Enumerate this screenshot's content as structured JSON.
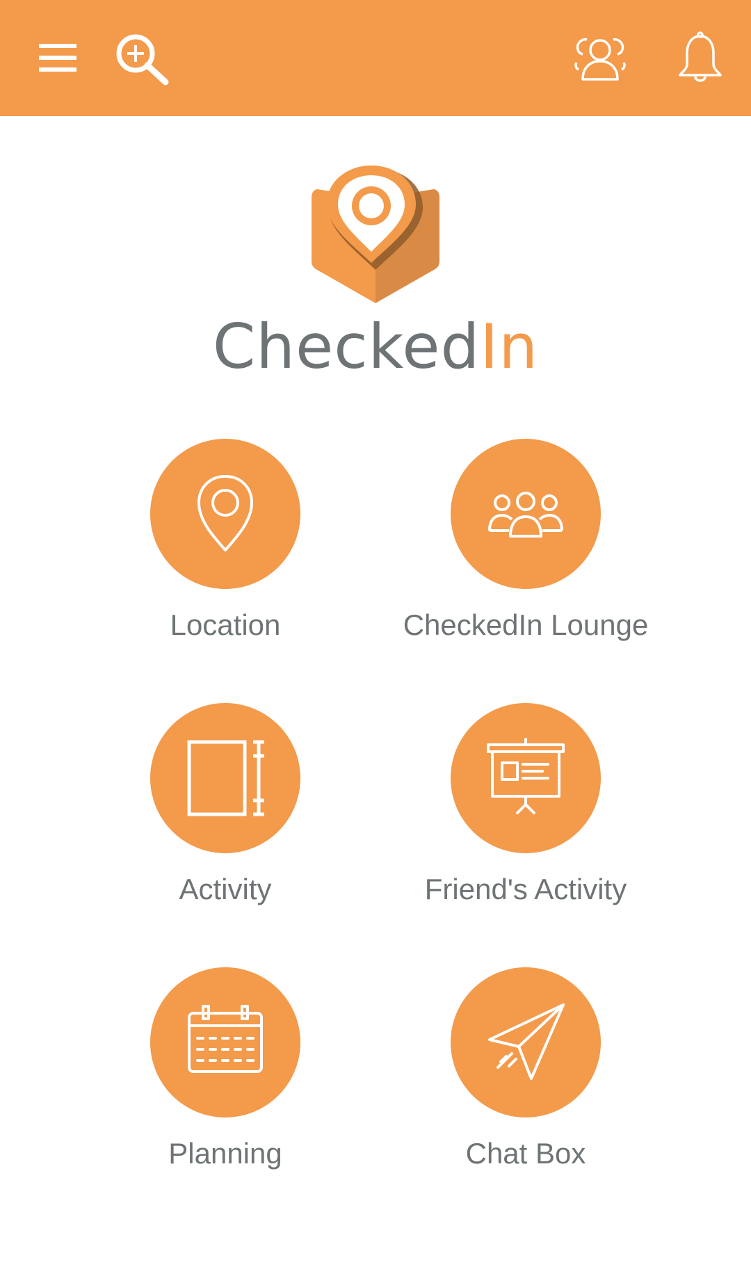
{
  "app": {
    "brand_part1": "Checked",
    "brand_part2": "In"
  },
  "toolbar": {
    "icons": [
      "menu-icon",
      "search-plus-icon",
      "user-profile-icon",
      "bell-icon"
    ]
  },
  "colors": {
    "accent": "#F39A4B",
    "text": "#6E7375",
    "background": "#FFFFFF"
  },
  "menu": {
    "items": [
      {
        "label": "Location",
        "icon": "location-pin-icon"
      },
      {
        "label": "CheckedIn Lounge",
        "icon": "group-icon"
      },
      {
        "label": "Activity",
        "icon": "notebook-icon"
      },
      {
        "label": "Friend's Activity",
        "icon": "presentation-board-icon"
      },
      {
        "label": "Planning",
        "icon": "calendar-icon"
      },
      {
        "label": "Chat Box",
        "icon": "paper-plane-icon"
      }
    ]
  }
}
